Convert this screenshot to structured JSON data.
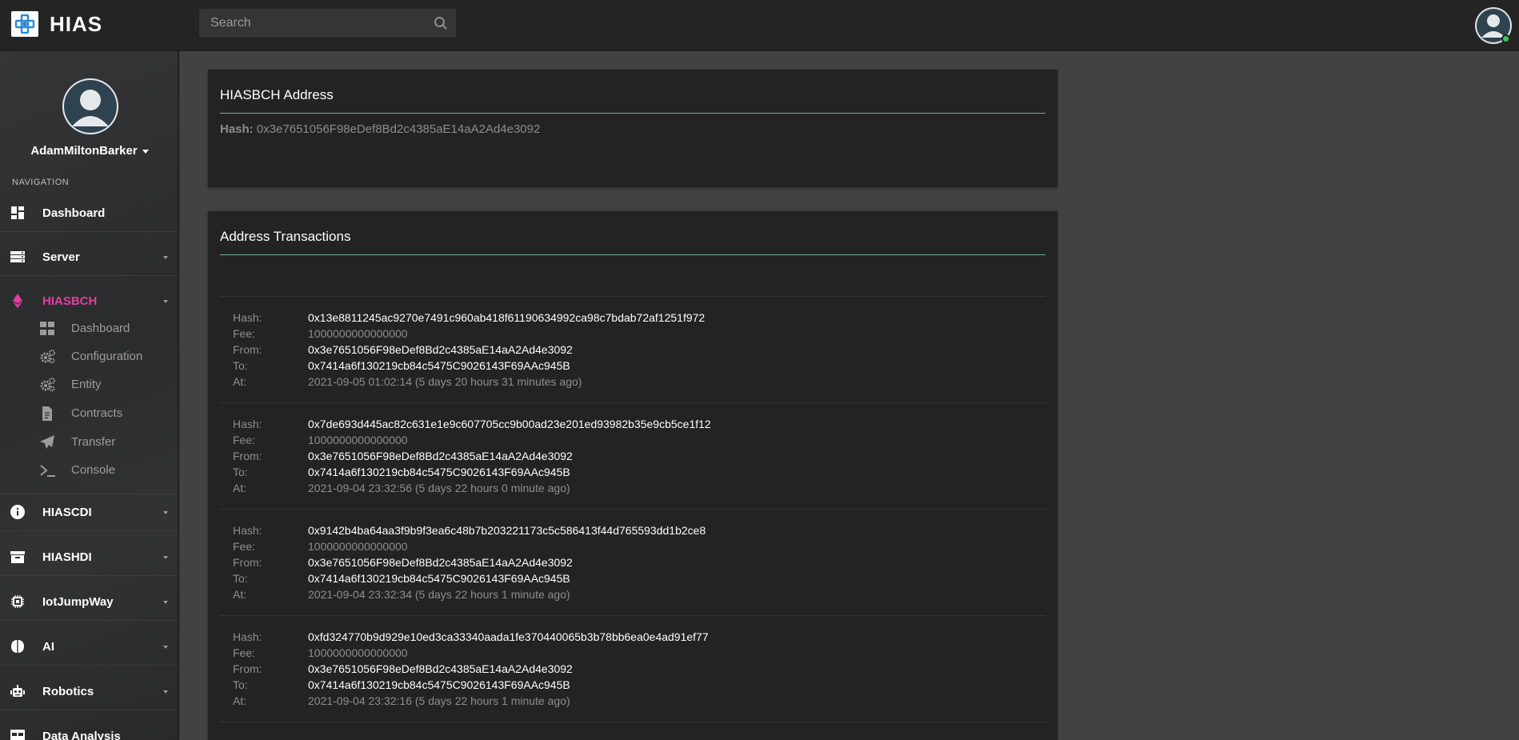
{
  "app": {
    "brand": "HIAS"
  },
  "search": {
    "placeholder": "Search"
  },
  "sidebar": {
    "username": "AdamMiltonBarker",
    "nav_heading": "NAVIGATION",
    "items": [
      {
        "label": "Dashboard",
        "icon": "dashboard-icon"
      },
      {
        "label": "Server",
        "icon": "server-icon"
      },
      {
        "label": "HIASBCH",
        "icon": "ethereum-icon"
      },
      {
        "label": "HIASCDI",
        "icon": "info-icon"
      },
      {
        "label": "HIASHDI",
        "icon": "archive-icon"
      },
      {
        "label": "IotJumpWay",
        "icon": "chip-icon"
      },
      {
        "label": "AI",
        "icon": "brain-icon"
      },
      {
        "label": "Robotics",
        "icon": "robot-icon"
      },
      {
        "label": "Data Analysis",
        "icon": "table-icon"
      }
    ],
    "hiasbch_sub": [
      {
        "label": "Dashboard",
        "icon": "dashboard-icon"
      },
      {
        "label": "Configuration",
        "icon": "gears-icon"
      },
      {
        "label": "Entity",
        "icon": "gears-icon"
      },
      {
        "label": "Contracts",
        "icon": "contract-icon"
      },
      {
        "label": "Transfer",
        "icon": "paper-plane-icon"
      },
      {
        "label": "Console",
        "icon": "terminal-icon"
      }
    ],
    "active_color": "#e040a0"
  },
  "address_card": {
    "title": "HIASBCH Address",
    "hash_label": "Hash:",
    "hash_value": "0x3e7651056F98eDef8Bd2c4385aE14aA2Ad4e3092"
  },
  "transactions_card": {
    "title": "Address Transactions",
    "labels": {
      "hash": "Hash:",
      "fee": "Fee:",
      "from": "From:",
      "to": "To:",
      "at": "At:"
    },
    "transactions": [
      {
        "hash": "0x13e8811245ac9270e7491c960ab418f61190634992ca98c7bdab72af1251f972",
        "fee": "1000000000000000",
        "from": "0x3e7651056F98eDef8Bd2c4385aE14aA2Ad4e3092",
        "to": "0x7414a6f130219cb84c5475C9026143F69AAc945B",
        "at": "2021-09-05 01:02:14 (5 days 20 hours 31 minutes ago)"
      },
      {
        "hash": "0x7de693d445ac82c631e1e9c607705cc9b00ad23e201ed93982b35e9cb5ce1f12",
        "fee": "1000000000000000",
        "from": "0x3e7651056F98eDef8Bd2c4385aE14aA2Ad4e3092",
        "to": "0x7414a6f130219cb84c5475C9026143F69AAc945B",
        "at": "2021-09-04 23:32:56 (5 days 22 hours 0 minute ago)"
      },
      {
        "hash": "0x9142b4ba64aa3f9b9f3ea6c48b7b203221173c5c586413f44d765593dd1b2ce8",
        "fee": "1000000000000000",
        "from": "0x3e7651056F98eDef8Bd2c4385aE14aA2Ad4e3092",
        "to": "0x7414a6f130219cb84c5475C9026143F69AAc945B",
        "at": "2021-09-04 23:32:34 (5 days 22 hours 1 minute ago)"
      },
      {
        "hash": "0xfd324770b9d929e10ed3ca33340aada1fe370440065b3b78bb6ea0e4ad91ef77",
        "fee": "1000000000000000",
        "from": "0x3e7651056F98eDef8Bd2c4385aE14aA2Ad4e3092",
        "to": "0x7414a6f130219cb84c5475C9026143F69AAc945B",
        "at": "2021-09-04 23:32:16 (5 days 22 hours 1 minute ago)"
      }
    ]
  }
}
